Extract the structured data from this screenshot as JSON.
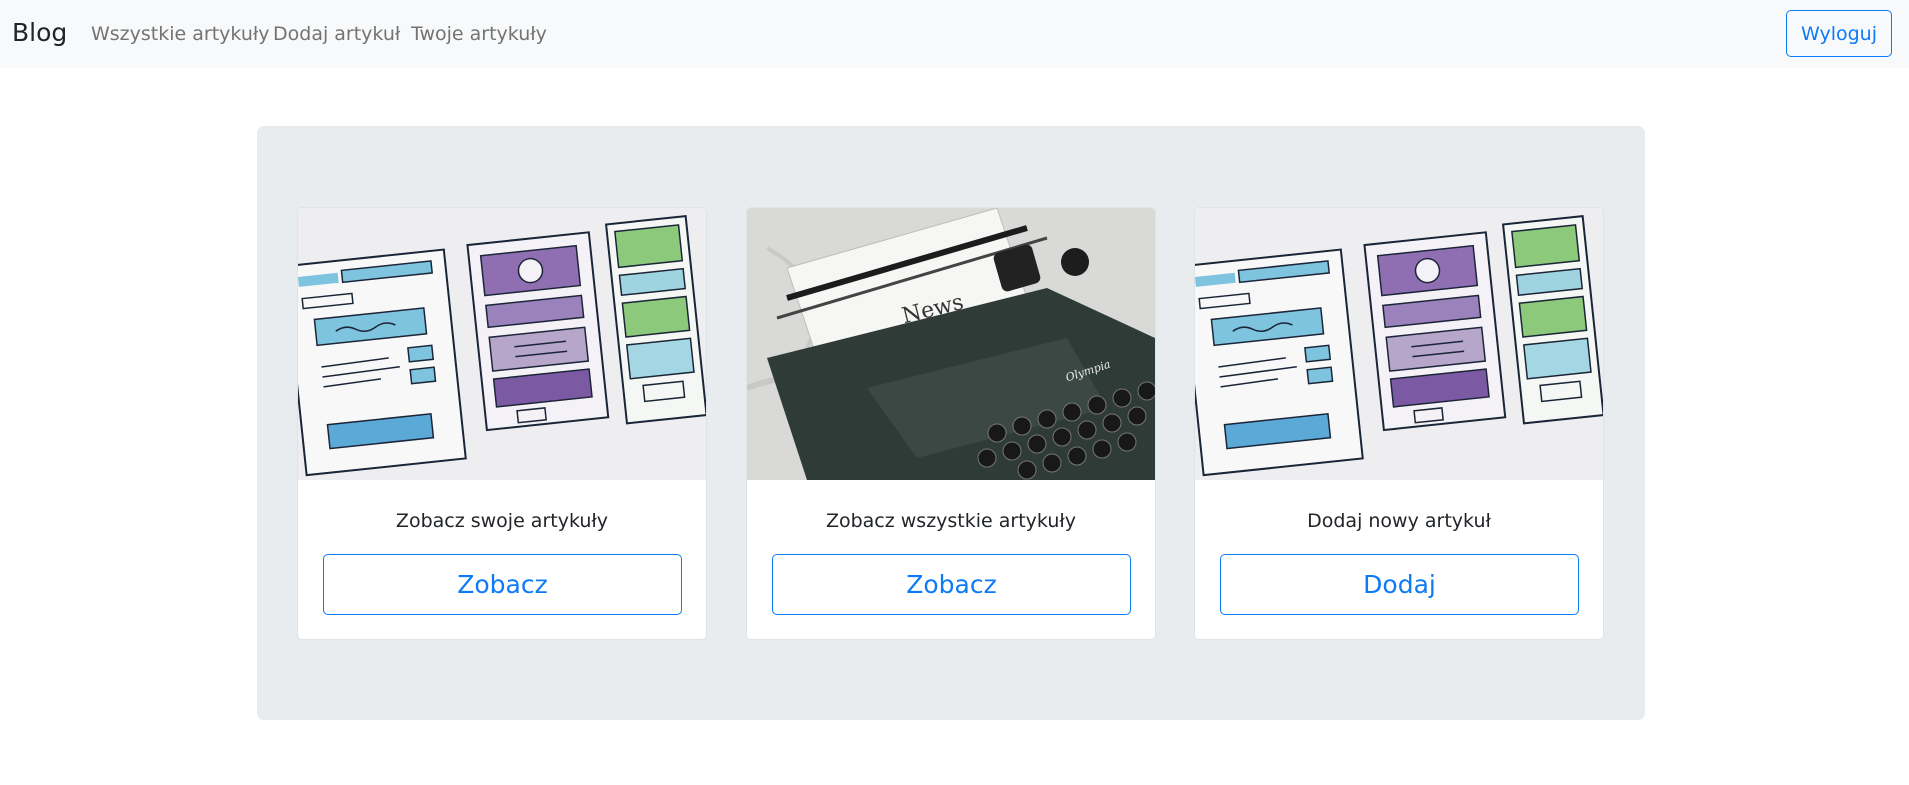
{
  "navbar": {
    "brand": "Blog",
    "links": [
      "Wszystkie artykuły",
      "Dodaj artykuł",
      "Twoje artykuły"
    ],
    "logout_label": "Wyloguj"
  },
  "cards": [
    {
      "image": "wireframe-sketch-image",
      "text": "Zobacz swoje artykuły",
      "button_label": "Zobacz"
    },
    {
      "image": "typewriter-news-image",
      "text": "Zobacz wszystkie artykuły",
      "button_label": "Zobacz",
      "image_text": {
        "paper": "News",
        "brand": "Olympia"
      }
    },
    {
      "image": "wireframe-sketch-image",
      "text": "Dodaj nowy artykuł",
      "button_label": "Dodaj"
    }
  ],
  "colors": {
    "primary": "#0d7bf7",
    "navbar_bg": "#f8f9fa",
    "jumbotron_bg": "#e9ecef"
  }
}
